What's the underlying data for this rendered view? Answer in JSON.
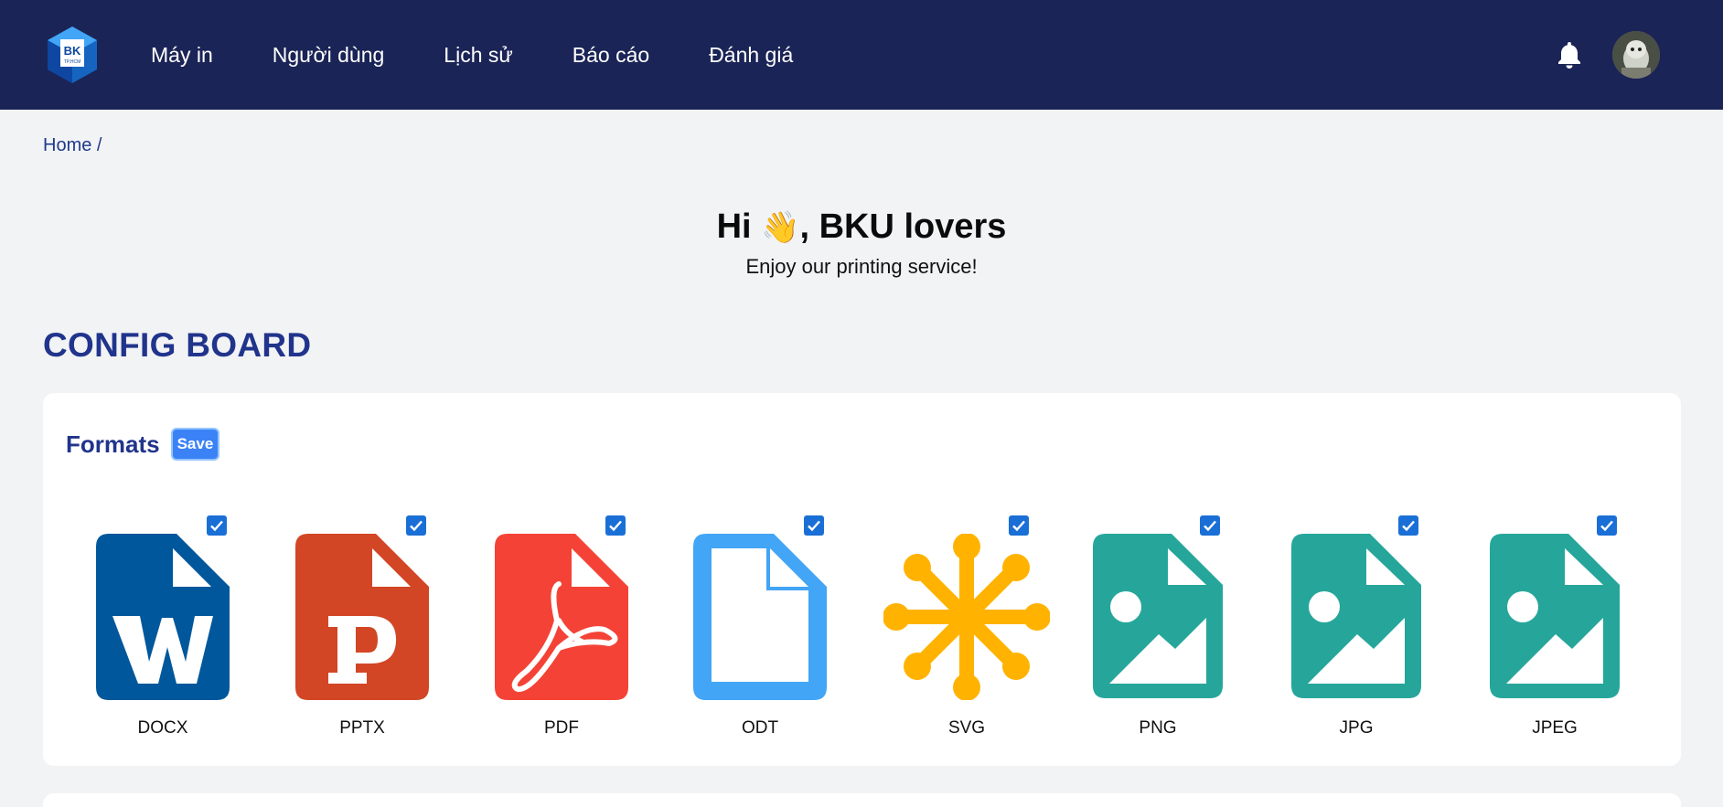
{
  "nav": {
    "logo_alt": "BK",
    "items": [
      {
        "label": "Máy in"
      },
      {
        "label": "Người dùng"
      },
      {
        "label": "Lịch sử"
      },
      {
        "label": "Báo cáo"
      },
      {
        "label": "Đánh giá"
      }
    ]
  },
  "breadcrumb": {
    "home": "Home",
    "separator": "/"
  },
  "greeting": {
    "title_prefix": "Hi",
    "wave": "👋",
    "title_suffix": ", BKU lovers",
    "subtitle": "Enjoy our printing service!"
  },
  "section_title": "CONFIG BOARD",
  "formats_card": {
    "title": "Formats",
    "save_label": "Save",
    "items": [
      {
        "label": "DOCX",
        "checked": true,
        "icon": "word-file-icon",
        "color": "#01579b"
      },
      {
        "label": "PPTX",
        "checked": true,
        "icon": "powerpoint-file-icon",
        "color": "#d24625"
      },
      {
        "label": "PDF",
        "checked": true,
        "icon": "pdf-file-icon",
        "color": "#f44336"
      },
      {
        "label": "ODT",
        "checked": true,
        "icon": "document-file-icon",
        "color": "#42a5f5"
      },
      {
        "label": "SVG",
        "checked": true,
        "icon": "svg-asterisk-icon",
        "color": "#ffb300"
      },
      {
        "label": "PNG",
        "checked": true,
        "icon": "image-file-icon",
        "color": "#26a69a"
      },
      {
        "label": "JPG",
        "checked": true,
        "icon": "image-file-icon",
        "color": "#26a69a"
      },
      {
        "label": "JPEG",
        "checked": true,
        "icon": "image-file-icon",
        "color": "#26a69a"
      }
    ]
  },
  "colors": {
    "topbar": "#1b2456",
    "accent": "#21348c",
    "checkbox": "#1a6fd6"
  }
}
